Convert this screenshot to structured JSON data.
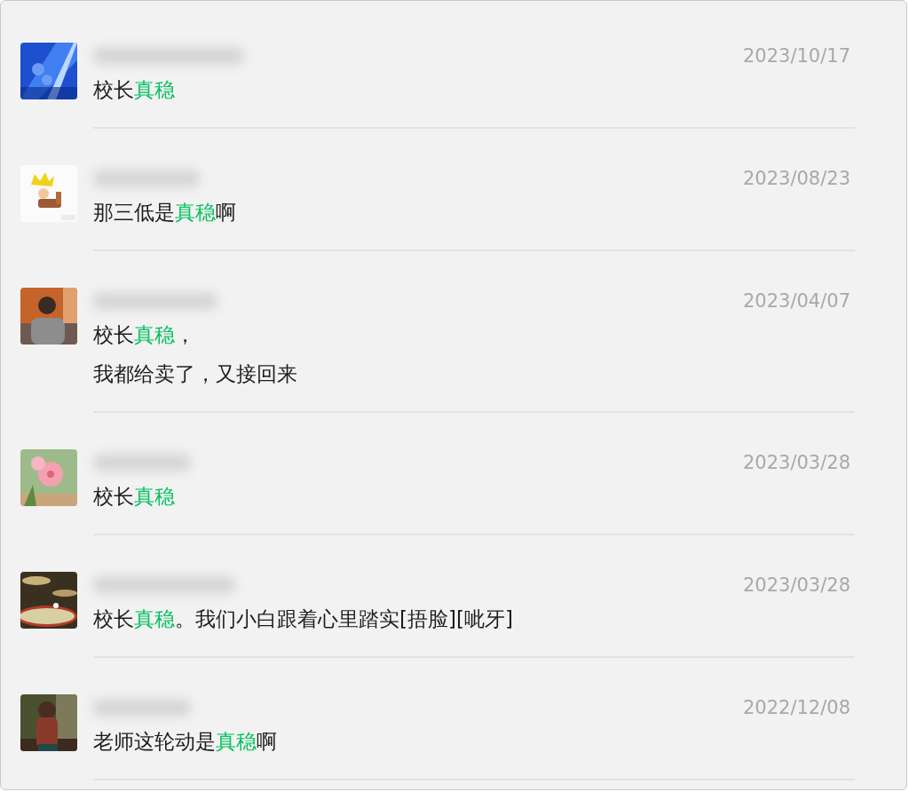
{
  "results": [
    {
      "avatar": {
        "kind": "picture"
      },
      "name_blurred": true,
      "date": "2023/10/17",
      "lines": [
        [
          {
            "text": "校长",
            "highlight": false
          },
          {
            "text": "真稳",
            "highlight": true
          }
        ]
      ]
    },
    {
      "avatar": {
        "kind": "picture"
      },
      "name_blurred": true,
      "date": "2023/08/23",
      "lines": [
        [
          {
            "text": "那三低是",
            "highlight": false
          },
          {
            "text": "真稳",
            "highlight": true
          },
          {
            "text": "啊",
            "highlight": false
          }
        ]
      ]
    },
    {
      "avatar": {
        "kind": "picture"
      },
      "name_blurred": true,
      "date": "2023/04/07",
      "lines": [
        [
          {
            "text": "校长",
            "highlight": false
          },
          {
            "text": "真稳",
            "highlight": true
          },
          {
            "text": "，",
            "highlight": false
          }
        ],
        [
          {
            "text": "我都给卖了，又接回来",
            "highlight": false
          }
        ]
      ]
    },
    {
      "avatar": {
        "kind": "picture"
      },
      "name_blurred": true,
      "date": "2023/03/28",
      "lines": [
        [
          {
            "text": "校长",
            "highlight": false
          },
          {
            "text": "真稳",
            "highlight": true
          }
        ]
      ]
    },
    {
      "avatar": {
        "kind": "picture"
      },
      "name_blurred": true,
      "date": "2023/03/28",
      "lines": [
        [
          {
            "text": "校长",
            "highlight": false
          },
          {
            "text": "真稳",
            "highlight": true
          },
          {
            "text": "。我们小白跟着心里踏实[捂脸][呲牙]",
            "highlight": false
          }
        ]
      ]
    },
    {
      "avatar": {
        "kind": "picture"
      },
      "name_blurred": true,
      "date": "2022/12/08",
      "lines": [
        [
          {
            "text": "老师这轮动是",
            "highlight": false
          },
          {
            "text": "真稳",
            "highlight": true
          },
          {
            "text": "啊",
            "highlight": false
          }
        ]
      ]
    }
  ]
}
